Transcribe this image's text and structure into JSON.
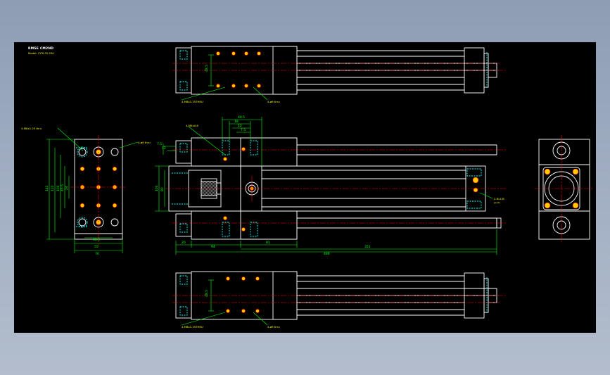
{
  "title_block": {
    "title": "RMSE CM2ND",
    "model": "Model: CY3L32-200"
  },
  "colors": {
    "background": "#8e9db4",
    "canvas": "#000000",
    "outline": "#ffffff",
    "dimension": "#00ff00",
    "centerline": "#ff0000",
    "hidden": "#00ffff",
    "hole_fill": "#ffcc00",
    "annotation": "#ffff00"
  },
  "labels": {
    "left_callout_1": "4-M8x1.25 thru",
    "left_callout_2": "4-ø9 thru",
    "front_callout_1": "4-M5x0.8",
    "right_port": "2-Rc1/8",
    "right_port_2": "(port)",
    "top_callout_1": "4-M8x1.25THRU",
    "top_callout_2": "4-ø9 thru",
    "bottom_callout_1": "4-M8x1.25THRU",
    "bottom_callout_2": "4-ø9 thru"
  },
  "dimensions": {
    "left_width": "70",
    "left_inner_width": "55",
    "left_bottom": "40.5",
    "left_h1": "141",
    "left_h2": "120",
    "left_h3": "100",
    "left_h4": "45.5",
    "left_h5": "24",
    "front_top_1": "40.5",
    "front_top_2": "18",
    "front_top_3": "12",
    "front_top_4": "7.5",
    "front_left_1": "7.5",
    "front_left_2": "12",
    "front_h1": "104",
    "front_h2": "80",
    "front_bottom_1": "20",
    "front_bottom_2": "94",
    "front_bottom_3": "81",
    "front_total_1": "486",
    "front_total_2": "351",
    "top_view_dim": "48.5",
    "bottom_view_dim": "48.5"
  }
}
